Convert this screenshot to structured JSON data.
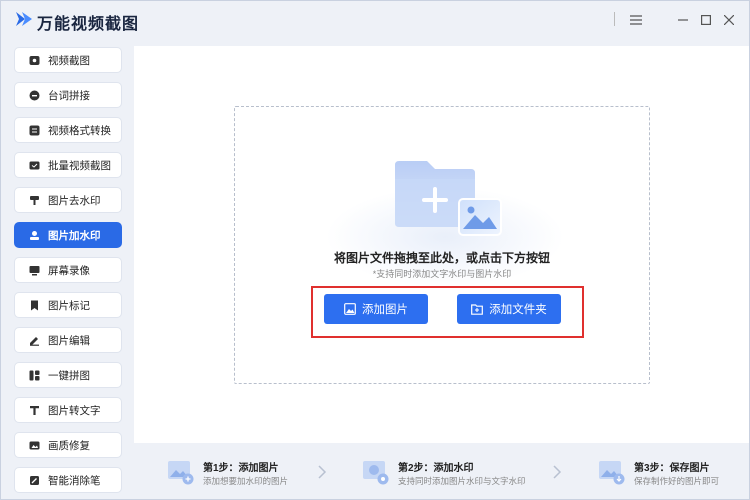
{
  "app": {
    "title": "万能视频截图",
    "colors": {
      "accent": "#2d6ff0",
      "active": "#2a6ae6",
      "highlight": "#e0302e",
      "background": "#eef1f7"
    }
  },
  "titlebar": {
    "menu_icon": "hamburger-icon",
    "minimize_icon": "minimize-icon",
    "maximize_icon": "maximize-icon",
    "close_icon": "close-icon"
  },
  "sidebar": {
    "items": [
      {
        "label": "视频截图",
        "icon": "video-screenshot-icon",
        "active": false
      },
      {
        "label": "台词拼接",
        "icon": "subtitle-stitch-icon",
        "active": false
      },
      {
        "label": "视频格式转换",
        "icon": "format-convert-icon",
        "active": false
      },
      {
        "label": "批量视频截图",
        "icon": "batch-screenshot-icon",
        "active": false
      },
      {
        "label": "图片去水印",
        "icon": "remove-watermark-icon",
        "active": false
      },
      {
        "label": "图片加水印",
        "icon": "add-watermark-icon",
        "active": true
      },
      {
        "label": "屏幕录像",
        "icon": "screen-record-icon",
        "active": false
      },
      {
        "label": "图片标记",
        "icon": "image-mark-icon",
        "active": false
      },
      {
        "label": "图片编辑",
        "icon": "image-edit-icon",
        "active": false
      },
      {
        "label": "一键拼图",
        "icon": "collage-icon",
        "active": false
      },
      {
        "label": "图片转文字",
        "icon": "ocr-text-icon",
        "active": false
      },
      {
        "label": "画质修复",
        "icon": "quality-repair-icon",
        "active": false
      },
      {
        "label": "智能消除笔",
        "icon": "eraser-pen-icon",
        "active": false
      }
    ]
  },
  "main": {
    "drop_title": "将图片文件拖拽至此处，或点击下方按钮",
    "drop_hint": "*支持同时添加文字水印与图片水印",
    "add_image_label": "添加图片",
    "add_folder_label": "添加文件夹"
  },
  "steps": [
    {
      "title": "第1步：添加图片",
      "desc": "添加想要加水印的图片",
      "icon": "add-image-step-icon"
    },
    {
      "title": "第2步：添加水印",
      "desc": "支持同时添加图片水印与文字水印",
      "icon": "add-watermark-step-icon"
    },
    {
      "title": "第3步：保存图片",
      "desc": "保存制作好的图片即可",
      "icon": "save-image-step-icon"
    }
  ]
}
